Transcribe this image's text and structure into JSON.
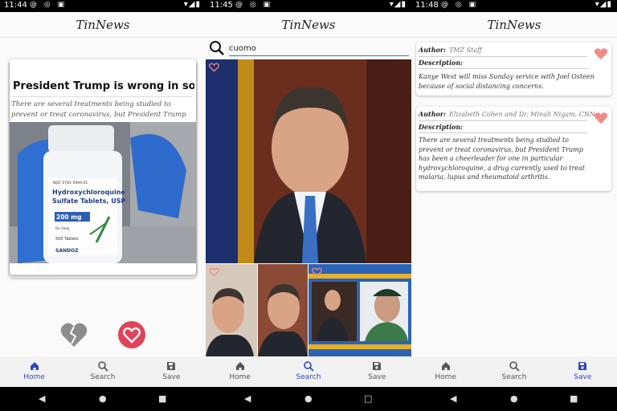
{
  "app_title": "TinNews",
  "nav_labels": {
    "home": "Home",
    "search": "Search",
    "save": "Save"
  },
  "colors": {
    "accent": "#2e47b8",
    "like": "#e04358",
    "heart": "#f08a84",
    "search_underline": "#1a8d8d"
  },
  "screens": [
    {
      "status_time": "11:44",
      "active_tab": "home",
      "card": {
        "title": "President Trump is wrong in so man...",
        "description": "There are several treatments being studied to prevent or treat coronavirus, but President Trump has been a",
        "image_label": {
          "code": "NDC 0781-5994-01",
          "line1": "Hydroxychloroquine",
          "line2": "Sulfate Tablets, USP",
          "dose": "200 mg",
          "rx": "Rx Only",
          "count": "500 Tablets",
          "brand": "SANDOZ"
        }
      }
    },
    {
      "status_time": "11:45",
      "active_tab": "search",
      "search_value": "cuomo"
    },
    {
      "status_time": "11:48",
      "active_tab": "save",
      "saved_items": [
        {
          "author_label": "Author:",
          "author": "TMZ Staff",
          "description_label": "Description:",
          "description": "Kanye West will miss Sunday service with Joel Osteen because of social distancing concerns."
        },
        {
          "author_label": "Author:",
          "author": "Elizabeth Cohen and Dr. Minali Nigam, CNN",
          "description_label": "Description:",
          "description": "There are several treatments being studied to prevent or treat coronavirus, but President Trump has been a cheerleader for one in particular hydroxychloroquine, a drug currently used to treat malaria, lupus and rheumatoid arthritis."
        }
      ]
    }
  ]
}
